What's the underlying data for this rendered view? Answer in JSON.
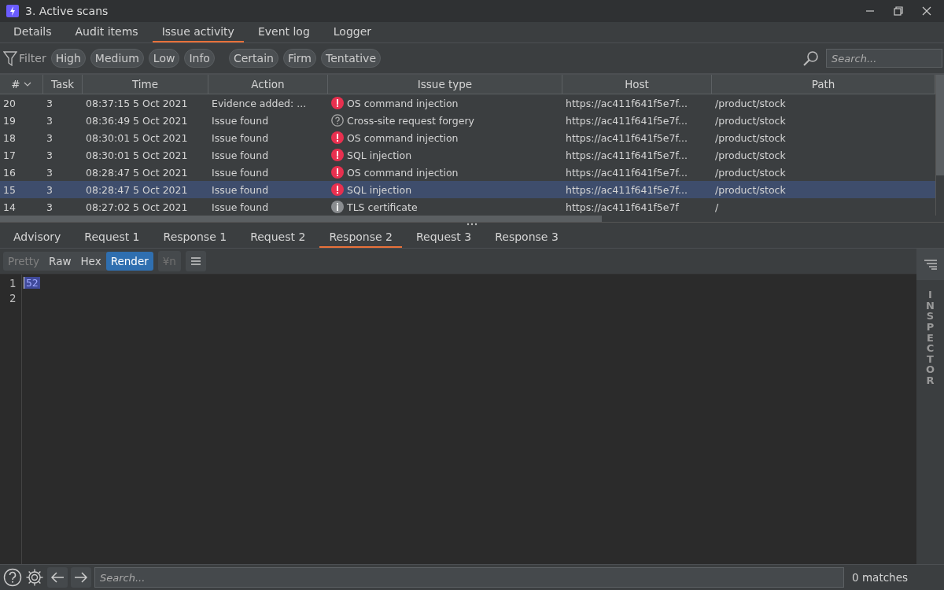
{
  "window": {
    "title": "3. Active scans"
  },
  "tabs": [
    {
      "label": "Details",
      "selected": false
    },
    {
      "label": "Audit items",
      "selected": false
    },
    {
      "label": "Issue activity",
      "selected": true
    },
    {
      "label": "Event log",
      "selected": false
    },
    {
      "label": "Logger",
      "selected": false
    }
  ],
  "filter": {
    "label": "Filter",
    "severity": [
      "High",
      "Medium",
      "Low",
      "Info"
    ],
    "confidence": [
      "Certain",
      "Firm",
      "Tentative"
    ],
    "search": {
      "placeholder": "Search..."
    }
  },
  "table": {
    "columns": [
      "#",
      "Task",
      "Time",
      "Action",
      "Issue type",
      "Host",
      "Path"
    ],
    "rows": [
      {
        "cells": [
          "20",
          "3",
          "08:37:15 5 Oct 2021",
          "Evidence added: ...",
          "OS command injection",
          "https://ac411f641f5e7f...",
          "/product/stock"
        ],
        "kind": "high",
        "selected": false
      },
      {
        "cells": [
          "19",
          "3",
          "08:36:49 5 Oct 2021",
          "Issue found",
          "Cross-site request forgery",
          "https://ac411f641f5e7f...",
          "/product/stock"
        ],
        "kind": "tentative",
        "selected": false
      },
      {
        "cells": [
          "18",
          "3",
          "08:30:01 5 Oct 2021",
          "Issue found",
          "OS command injection",
          "https://ac411f641f5e7f...",
          "/product/stock"
        ],
        "kind": "high",
        "selected": false
      },
      {
        "cells": [
          "17",
          "3",
          "08:30:01 5 Oct 2021",
          "Issue found",
          "SQL injection",
          "https://ac411f641f5e7f...",
          "/product/stock"
        ],
        "kind": "high",
        "selected": false
      },
      {
        "cells": [
          "16",
          "3",
          "08:28:47 5 Oct 2021",
          "Issue found",
          "OS command injection",
          "https://ac411f641f5e7f...",
          "/product/stock"
        ],
        "kind": "high",
        "selected": false
      },
      {
        "cells": [
          "15",
          "3",
          "08:28:47 5 Oct 2021",
          "Issue found",
          "SQL injection",
          "https://ac411f641f5e7f...",
          "/product/stock"
        ],
        "kind": "high",
        "selected": true
      },
      {
        "cells": [
          "14",
          "3",
          "08:27:02 5 Oct 2021",
          "Issue found",
          "TLS certificate",
          "https://ac411f641f5e7f",
          "/"
        ],
        "kind": "info",
        "selected": false
      }
    ]
  },
  "detail_tabs": [
    {
      "label": "Advisory",
      "selected": false
    },
    {
      "label": "Request 1",
      "selected": false
    },
    {
      "label": "Response 1",
      "selected": false
    },
    {
      "label": "Request 2",
      "selected": false
    },
    {
      "label": "Response 2",
      "selected": true
    },
    {
      "label": "Request 3",
      "selected": false
    },
    {
      "label": "Response 3",
      "selected": false
    }
  ],
  "view_modes": [
    {
      "label": "Pretty",
      "selected": false,
      "disabled": true
    },
    {
      "label": "Raw",
      "selected": false,
      "disabled": false
    },
    {
      "label": "Hex",
      "selected": false,
      "disabled": false
    },
    {
      "label": "Render",
      "selected": true,
      "disabled": false
    }
  ],
  "newline_button": {
    "label": "¥n",
    "disabled": true
  },
  "editor": {
    "lines": [
      {
        "number": "1",
        "text": "52",
        "selected": true
      },
      {
        "number": "2"
      }
    ]
  },
  "inspector": {
    "label": "INSPECTOR"
  },
  "bottom_bar": {
    "search": {
      "placeholder": "Search..."
    },
    "matches": "0 matches"
  }
}
